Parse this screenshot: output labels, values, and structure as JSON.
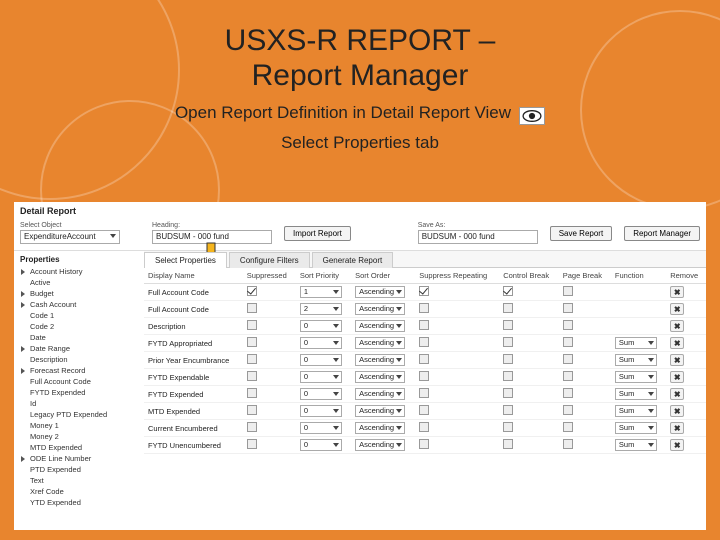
{
  "slide": {
    "title_line1": "USXS-R REPORT –",
    "title_line2": "Report Manager",
    "subtitle": "Open Report Definition in Detail Report View",
    "subtitle2": "Select Properties tab"
  },
  "app": {
    "header": "Detail Report",
    "topBar": {
      "selectObject": {
        "label": "Select Object",
        "value": "ExpenditureAccount"
      },
      "heading": {
        "label": "Heading:",
        "value": "BUDSUM - 000 fund"
      },
      "importBtn": "Import Report",
      "saveAs": {
        "label": "Save As:",
        "value": "BUDSUM - 000 fund"
      },
      "saveBtn": "Save Report",
      "managerBtn": "Report Manager"
    },
    "sidebar": {
      "title": "Properties",
      "items": [
        {
          "label": "Account History",
          "caret": true
        },
        {
          "label": "Active",
          "caret": false
        },
        {
          "label": "Budget",
          "caret": true
        },
        {
          "label": "Cash Account",
          "caret": true
        },
        {
          "label": "Code 1",
          "caret": false
        },
        {
          "label": "Code 2",
          "caret": false
        },
        {
          "label": "Date",
          "caret": false
        },
        {
          "label": "Date Range",
          "caret": true
        },
        {
          "label": "Description",
          "caret": false
        },
        {
          "label": "Forecast Record",
          "caret": true
        },
        {
          "label": "Full Account Code",
          "caret": false
        },
        {
          "label": "FYTD Expended",
          "caret": false
        },
        {
          "label": "Id",
          "caret": false
        },
        {
          "label": "Legacy PTD Expended",
          "caret": false
        },
        {
          "label": "Money 1",
          "caret": false
        },
        {
          "label": "Money 2",
          "caret": false
        },
        {
          "label": "MTD Expended",
          "caret": false
        },
        {
          "label": "ODE Line Number",
          "caret": true
        },
        {
          "label": "PTD Expended",
          "caret": false
        },
        {
          "label": "Text",
          "caret": false
        },
        {
          "label": "Xref Code",
          "caret": false
        },
        {
          "label": "YTD Expended",
          "caret": false
        }
      ]
    },
    "tabs": [
      {
        "label": "Select Properties",
        "active": true
      },
      {
        "label": "Configure Filters",
        "active": false
      },
      {
        "label": "Generate Report",
        "active": false
      }
    ],
    "columns": [
      "Display Name",
      "Suppressed",
      "Sort Priority",
      "Sort Order",
      "Suppress Repeating",
      "Control Break",
      "Page Break",
      "Function",
      "Remove"
    ],
    "rows": [
      {
        "name": "Full Account Code",
        "suppressed": true,
        "sortPriority": "1",
        "sortOrder": "Ascending",
        "suppressRepeating": true,
        "controlBreak": true,
        "pageBreak": false,
        "function": "",
        "remove": true
      },
      {
        "name": "Full Account Code",
        "suppressed": false,
        "sortPriority": "2",
        "sortOrder": "Ascending",
        "suppressRepeating": false,
        "controlBreak": false,
        "pageBreak": false,
        "function": "",
        "remove": true
      },
      {
        "name": "Description",
        "suppressed": false,
        "sortPriority": "0",
        "sortOrder": "Ascending",
        "suppressRepeating": false,
        "controlBreak": false,
        "pageBreak": false,
        "function": "",
        "remove": true
      },
      {
        "name": "FYTD Appropriated",
        "suppressed": false,
        "sortPriority": "0",
        "sortOrder": "Ascending",
        "suppressRepeating": false,
        "controlBreak": false,
        "pageBreak": false,
        "function": "Sum",
        "remove": true
      },
      {
        "name": "Prior Year Encumbrance",
        "suppressed": false,
        "sortPriority": "0",
        "sortOrder": "Ascending",
        "suppressRepeating": false,
        "controlBreak": false,
        "pageBreak": false,
        "function": "Sum",
        "remove": true
      },
      {
        "name": "FYTD Expendable",
        "suppressed": false,
        "sortPriority": "0",
        "sortOrder": "Ascending",
        "suppressRepeating": false,
        "controlBreak": false,
        "pageBreak": false,
        "function": "Sum",
        "remove": true
      },
      {
        "name": "FYTD Expended",
        "suppressed": false,
        "sortPriority": "0",
        "sortOrder": "Ascending",
        "suppressRepeating": false,
        "controlBreak": false,
        "pageBreak": false,
        "function": "Sum",
        "remove": true
      },
      {
        "name": "MTD Expended",
        "suppressed": false,
        "sortPriority": "0",
        "sortOrder": "Ascending",
        "suppressRepeating": false,
        "controlBreak": false,
        "pageBreak": false,
        "function": "Sum",
        "remove": true
      },
      {
        "name": "Current Encumbered",
        "suppressed": false,
        "sortPriority": "0",
        "sortOrder": "Ascending",
        "suppressRepeating": false,
        "controlBreak": false,
        "pageBreak": false,
        "function": "Sum",
        "remove": true
      },
      {
        "name": "FYTD Unencumbered",
        "suppressed": false,
        "sortPriority": "0",
        "sortOrder": "Ascending",
        "suppressRepeating": false,
        "controlBreak": false,
        "pageBreak": false,
        "function": "Sum",
        "remove": true
      }
    ]
  }
}
